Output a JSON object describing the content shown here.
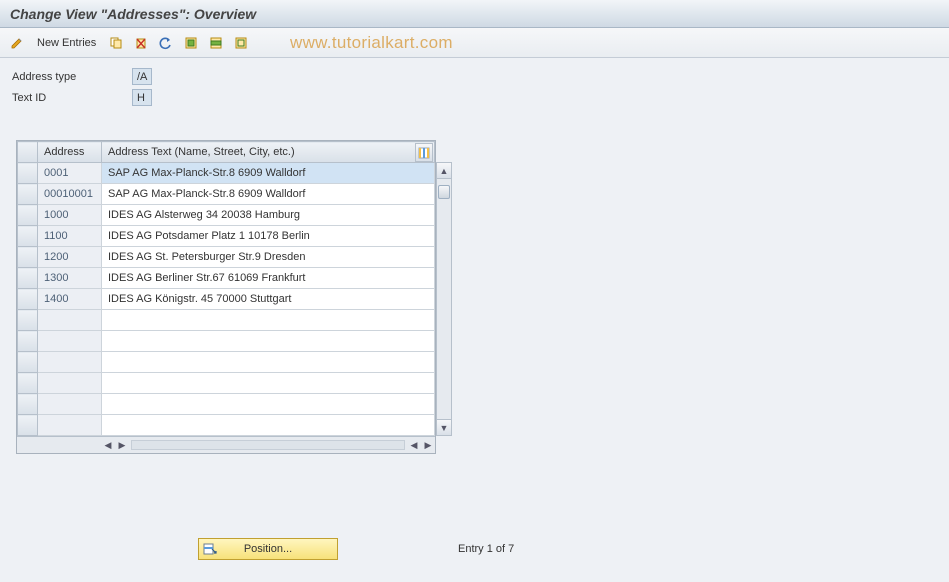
{
  "title": "Change View \"Addresses\": Overview",
  "toolbar": {
    "new_entries_label": "New Entries"
  },
  "watermark": "www.tutorialkart.com",
  "fields": {
    "address_type": {
      "label": "Address type",
      "value": "/A"
    },
    "text_id": {
      "label": "Text ID",
      "value": "H"
    }
  },
  "table": {
    "headers": {
      "address": "Address",
      "text": "Address Text (Name, Street, City, etc.)"
    },
    "rows": [
      {
        "address": "0001",
        "text": "SAP AG Max-Planck-Str.8 6909 Walldorf",
        "selected": true
      },
      {
        "address": "00010001",
        "text": "SAP AG Max-Planck-Str.8 6909 Walldorf"
      },
      {
        "address": "1000",
        "text": "IDES AG Alsterweg 34 20038 Hamburg"
      },
      {
        "address": "1100",
        "text": "IDES AG Potsdamer Platz 1 10178 Berlin"
      },
      {
        "address": "1200",
        "text": "IDES AG St. Petersburger Str.9 Dresden"
      },
      {
        "address": "1300",
        "text": "IDES AG Berliner Str.67 61069 Frankfurt"
      },
      {
        "address": "1400",
        "text": "IDES AG Königstr. 45 70000 Stuttgart"
      },
      {
        "address": "",
        "text": ""
      },
      {
        "address": "",
        "text": ""
      },
      {
        "address": "",
        "text": ""
      },
      {
        "address": "",
        "text": ""
      },
      {
        "address": "",
        "text": ""
      },
      {
        "address": "",
        "text": ""
      }
    ]
  },
  "footer": {
    "position_label": "Position...",
    "entry_text": "Entry 1 of 7"
  }
}
